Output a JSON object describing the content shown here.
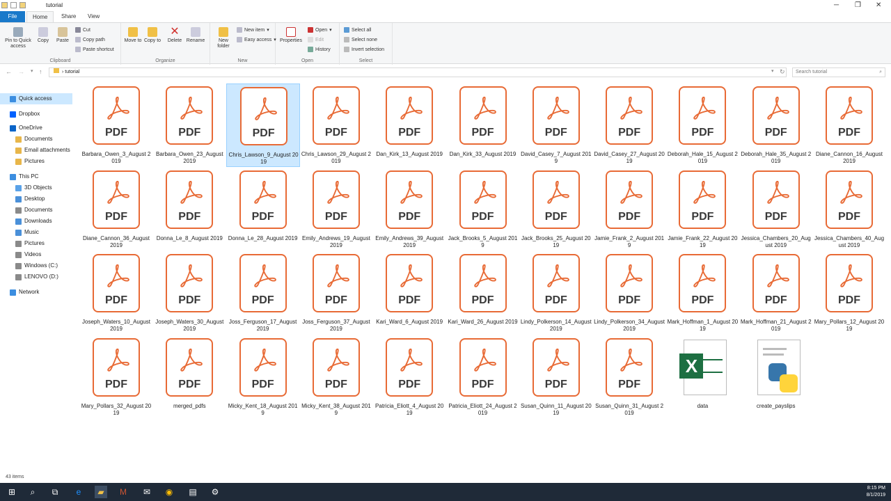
{
  "window": {
    "title": "tutorial"
  },
  "tabs": [
    "File",
    "Home",
    "Share",
    "View"
  ],
  "ribbon": {
    "clipboard": {
      "label": "Clipboard",
      "pin": "Pin to Quick access",
      "copy": "Copy",
      "paste": "Paste",
      "cut": "Cut",
      "copy_path": "Copy path",
      "paste_shortcut": "Paste shortcut"
    },
    "organize": {
      "label": "Organize",
      "move_to": "Move to",
      "copy_to": "Copy to",
      "delete": "Delete",
      "rename": "Rename"
    },
    "new": {
      "label": "New",
      "new_folder": "New folder",
      "new_item": "New item",
      "easy_access": "Easy access"
    },
    "open": {
      "label": "Open",
      "properties": "Properties",
      "open": "Open",
      "edit": "Edit",
      "history": "History"
    },
    "select": {
      "label": "Select",
      "select_all": "Select all",
      "select_none": "Select none",
      "invert": "Invert selection"
    }
  },
  "address": {
    "path": "tutorial",
    "search_placeholder": "Search tutorial"
  },
  "sidebar": [
    {
      "label": "Quick access",
      "selected": true,
      "color": "#3c8ee0"
    },
    {
      "label": "Dropbox",
      "color": "#0061fe"
    },
    {
      "label": "OneDrive",
      "color": "#0a64c8"
    },
    {
      "label": "Documents",
      "color": "#e8b64a"
    },
    {
      "label": "Email attachments",
      "color": "#e8b64a"
    },
    {
      "label": "Pictures",
      "color": "#e8b64a"
    },
    {
      "label": "This PC",
      "color": "#3c8ee0"
    },
    {
      "label": "3D Objects",
      "color": "#5aa2e8"
    },
    {
      "label": "Desktop",
      "color": "#4a90d9"
    },
    {
      "label": "Documents",
      "color": "#8a8a8a"
    },
    {
      "label": "Downloads",
      "color": "#4a90d9"
    },
    {
      "label": "Music",
      "color": "#4a90d9"
    },
    {
      "label": "Pictures",
      "color": "#8a8a8a"
    },
    {
      "label": "Videos",
      "color": "#8a8a8a"
    },
    {
      "label": "Windows (C:)",
      "color": "#8a8a8a"
    },
    {
      "label": "LENOVO (D:)",
      "color": "#8a8a8a"
    },
    {
      "label": "Network",
      "color": "#3c8ee0"
    }
  ],
  "files": [
    {
      "name": "Barbara_Owen_3_August 2019",
      "type": "pdf"
    },
    {
      "name": "Barbara_Owen_23_August 2019",
      "type": "pdf"
    },
    {
      "name": "Chris_Lawson_9_August 2019",
      "type": "pdf",
      "selected": true
    },
    {
      "name": "Chris_Lawson_29_August 2019",
      "type": "pdf"
    },
    {
      "name": "Dan_Kirk_13_August 2019",
      "type": "pdf"
    },
    {
      "name": "Dan_Kirk_33_August 2019",
      "type": "pdf"
    },
    {
      "name": "David_Casey_7_August 2019",
      "type": "pdf"
    },
    {
      "name": "David_Casey_27_August 2019",
      "type": "pdf"
    },
    {
      "name": "Deborah_Hale_15_August 2019",
      "type": "pdf"
    },
    {
      "name": "Deborah_Hale_35_August 2019",
      "type": "pdf"
    },
    {
      "name": "Diane_Cannon_16_August 2019",
      "type": "pdf"
    },
    {
      "name": "Diane_Cannon_36_August 2019",
      "type": "pdf"
    },
    {
      "name": "Donna_Le_8_August 2019",
      "type": "pdf"
    },
    {
      "name": "Donna_Le_28_August 2019",
      "type": "pdf"
    },
    {
      "name": "Emily_Andrews_19_August 2019",
      "type": "pdf"
    },
    {
      "name": "Emily_Andrews_39_August 2019",
      "type": "pdf"
    },
    {
      "name": "Jack_Brooks_5_August 2019",
      "type": "pdf"
    },
    {
      "name": "Jack_Brooks_25_August 2019",
      "type": "pdf"
    },
    {
      "name": "Jamie_Frank_2_August 2019",
      "type": "pdf"
    },
    {
      "name": "Jamie_Frank_22_August 2019",
      "type": "pdf"
    },
    {
      "name": "Jessica_Chambers_20_August 2019",
      "type": "pdf"
    },
    {
      "name": "Jessica_Chambers_40_August 2019",
      "type": "pdf"
    },
    {
      "name": "Joseph_Waters_10_August 2019",
      "type": "pdf"
    },
    {
      "name": "Joseph_Waters_30_August 2019",
      "type": "pdf"
    },
    {
      "name": "Joss_Ferguson_17_August 2019",
      "type": "pdf"
    },
    {
      "name": "Joss_Ferguson_37_August 2019",
      "type": "pdf"
    },
    {
      "name": "Kari_Ward_6_August 2019",
      "type": "pdf"
    },
    {
      "name": "Kari_Ward_26_August 2019",
      "type": "pdf"
    },
    {
      "name": "Lindy_Polkerson_14_August 2019",
      "type": "pdf"
    },
    {
      "name": "Lindy_Polkerson_34_August 2019",
      "type": "pdf"
    },
    {
      "name": "Mark_Hoffman_1_August 2019",
      "type": "pdf"
    },
    {
      "name": "Mark_Hoffman_21_August 2019",
      "type": "pdf"
    },
    {
      "name": "Mary_Pollars_12_August 2019",
      "type": "pdf"
    },
    {
      "name": "Mary_Pollars_32_August 2019",
      "type": "pdf"
    },
    {
      "name": "merged_pdfs",
      "type": "pdf"
    },
    {
      "name": "Micky_Kent_18_August 2019",
      "type": "pdf"
    },
    {
      "name": "Micky_Kent_38_August 2019",
      "type": "pdf"
    },
    {
      "name": "Patricia_Eliott_4_August 2019",
      "type": "pdf"
    },
    {
      "name": "Patricia_Eliott_24_August 2019",
      "type": "pdf"
    },
    {
      "name": "Susan_Quinn_11_August 2019",
      "type": "pdf"
    },
    {
      "name": "Susan_Quinn_31_August 2019",
      "type": "pdf"
    },
    {
      "name": "data",
      "type": "xlsx"
    },
    {
      "name": "create_payslips",
      "type": "py"
    }
  ],
  "pdf_label": "PDF",
  "xl_label": "X",
  "status": {
    "count": "43 items"
  },
  "clock": {
    "time": "8:15 PM",
    "date": "8/1/2019"
  }
}
